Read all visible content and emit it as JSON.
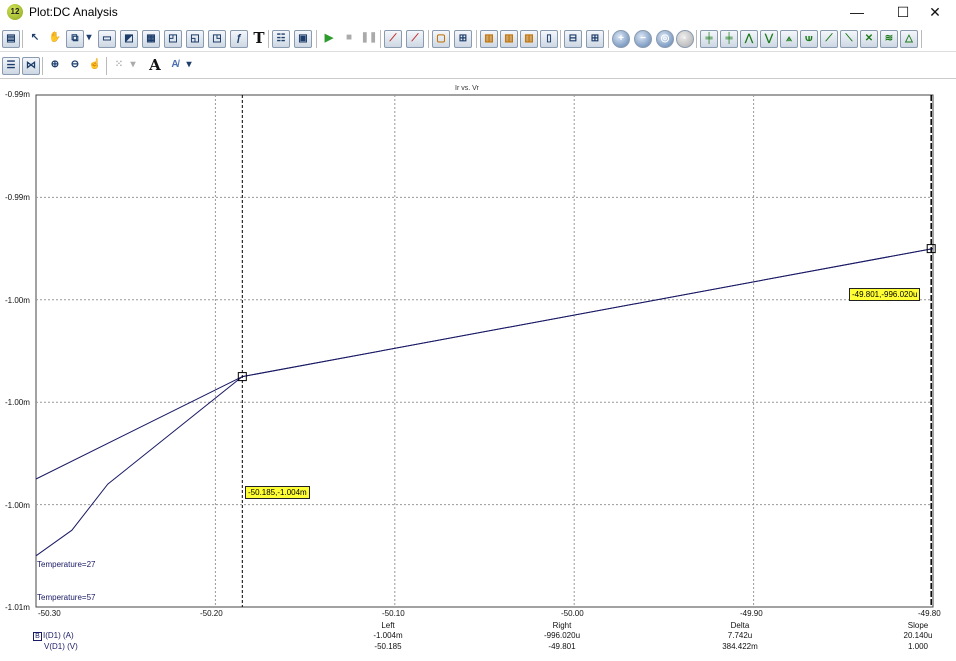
{
  "window": {
    "icon_text": "12",
    "title": "Plot:DC Analysis",
    "minimize": "—",
    "maximize": "☐",
    "close": "✕"
  },
  "plot": {
    "title": "Ir vs. Vr",
    "y_ticks": [
      "-0.99m",
      "-0.99m",
      "-1.00m",
      "-1.00m",
      "-1.00m",
      "-1.01m"
    ],
    "x_ticks": [
      "-50.30",
      "-50.20",
      "-50.10",
      "-50.00",
      "-49.90",
      "-49.80"
    ],
    "cursor_left_label": "-50.185,-1.004m",
    "cursor_right_label": "-49.801,-996.020u",
    "curves": [
      {
        "label": "Temperature=27"
      },
      {
        "label": "Temperature=57"
      }
    ],
    "colors": {
      "curve": "#1a1a66",
      "cursor_label": "#ffff33",
      "grid": "#999999"
    }
  },
  "chart_data": {
    "type": "line",
    "title": "Ir vs. Vr",
    "xlim": [
      -50.3,
      -49.8
    ],
    "ylim": [
      -1.01,
      -0.99
    ],
    "x_ticks": [
      -50.3,
      -50.2,
      -50.1,
      -50.0,
      -49.9,
      -49.8
    ],
    "series": [
      {
        "name": "Temperature=27",
        "x": [
          -50.3,
          -50.185,
          -49.8
        ],
        "y": [
          -1.005,
          -1.001,
          -0.996
        ]
      },
      {
        "name": "Temperature=57",
        "x": [
          -50.3,
          -50.28,
          -50.26,
          -50.185,
          -49.8
        ],
        "y": [
          -1.008,
          -1.007,
          -1.0052,
          -1.001,
          -0.996
        ]
      }
    ],
    "cursors": [
      {
        "x": -50.185,
        "y": -1.004
      },
      {
        "x": -49.801,
        "y": -0.99602
      }
    ]
  },
  "readouts": {
    "headers": [
      "Left",
      "Right",
      "Delta",
      "Slope"
    ],
    "rows": [
      {
        "badge": "B",
        "name": "I(D1) (A)",
        "values": [
          "-1.004m",
          "-996.020u",
          "7.742u",
          "20.140u"
        ]
      },
      {
        "name": "V(D1) (V)",
        "values": [
          "-50.185",
          "-49.801",
          "384.422m",
          "1.000"
        ]
      }
    ]
  },
  "toolbar_icons": {
    "row1": [
      "print-icon",
      "pointer-icon",
      "pan-icon",
      "copy-icon",
      "dropdown-icon",
      "view-icon",
      "chart-icon",
      "grid-icon",
      "axis-icon",
      "zoom-box-icon",
      "zoom-x-icon",
      "function-icon",
      "text-icon",
      "properties-icon",
      "export-icon",
      "play-icon",
      "stop-icon",
      "pause-icon",
      "cursor-a-icon",
      "cursor-b-icon",
      "layout-icon",
      "tile-icon",
      "zoom-in-icon",
      "zoom-out-icon",
      "zoom-fit-icon",
      "zoom-reset-icon",
      "peak-icon",
      "valley-icon"
    ],
    "row2": [
      "fit-icon",
      "marker-icon",
      "zoom-plus-icon",
      "zoom-minus-icon",
      "pan-plot-icon",
      "points-icon",
      "font-icon",
      "format-icon"
    ]
  }
}
